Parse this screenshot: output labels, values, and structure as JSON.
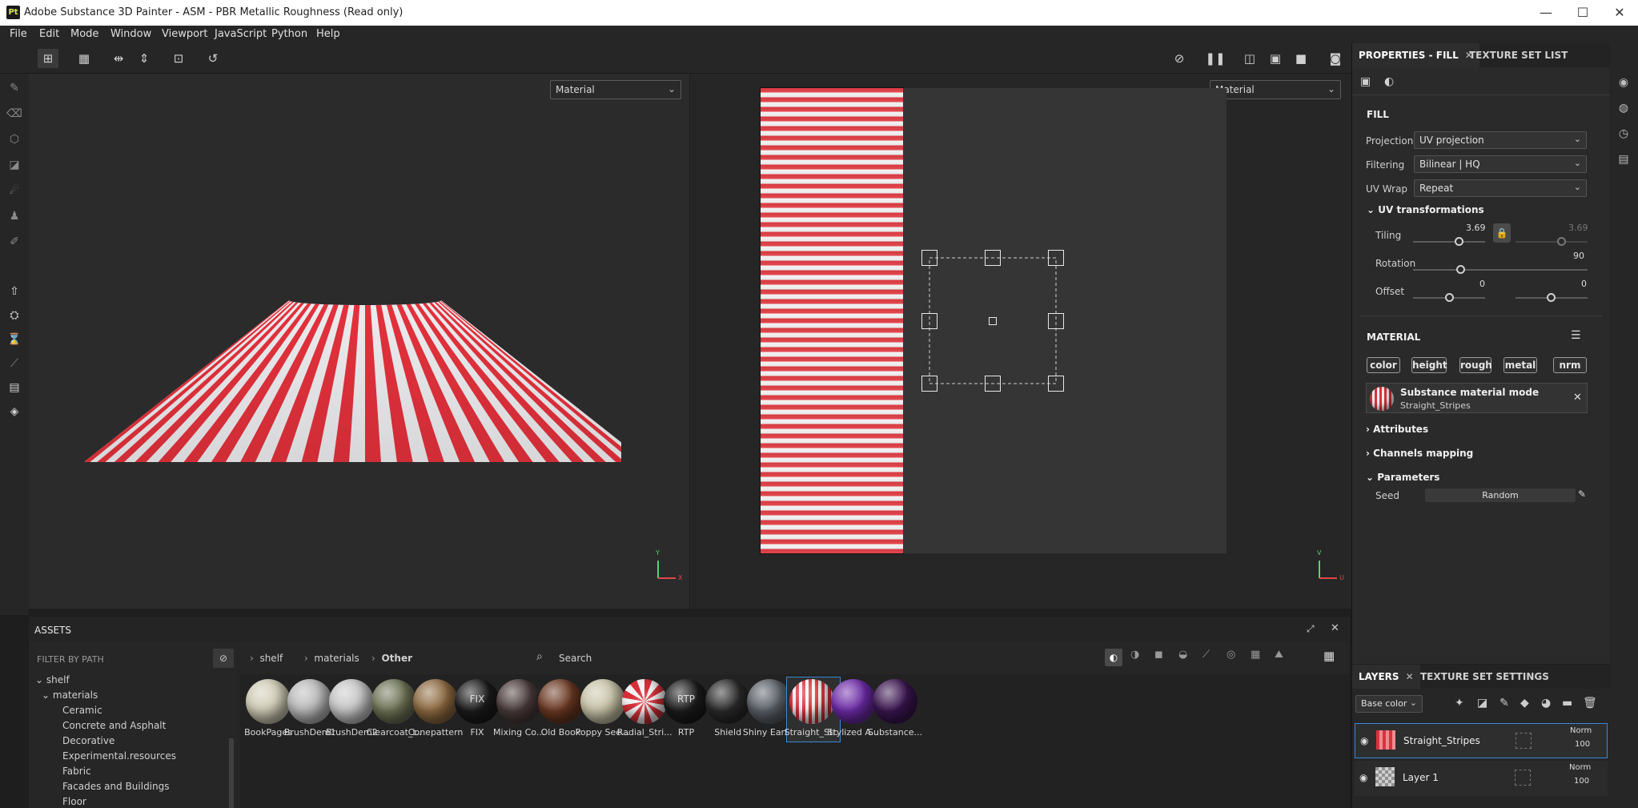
{
  "window": {
    "title": "Adobe Substance 3D Painter - ASM - PBR Metallic Roughness (Read only)",
    "logo": "Pt",
    "minimize": "—",
    "maximize": "☐",
    "close": "✕"
  },
  "menu": [
    "File",
    "Edit",
    "Mode",
    "Window",
    "Viewport",
    "JavaScript",
    "Python",
    "Help"
  ],
  "viewport3d": {
    "channel": "Material",
    "axis_x": "X",
    "axis_y": "Y"
  },
  "viewport2d": {
    "channel": "Material",
    "axis_u": "U",
    "axis_v": "V"
  },
  "properties": {
    "tab_active": "PROPERTIES - FILL",
    "tab_other": "TEXTURE SET LIST",
    "fill_title": "FILL",
    "projection_label": "Projection",
    "projection_value": "UV projection",
    "filtering_label": "Filtering",
    "filtering_value": "Bilinear | HQ",
    "uvwrap_label": "UV Wrap",
    "uvwrap_value": "Repeat",
    "uvtrans_title": "UV transformations",
    "tiling_label": "Tiling",
    "tiling_value": "3.69",
    "tiling_value2": "3.69",
    "rotation_label": "Rotation",
    "rotation_value": "90",
    "offset_label": "Offset",
    "offset_u": "0",
    "offset_v": "0",
    "material_title": "MATERIAL",
    "channels": [
      "color",
      "height",
      "rough",
      "metal",
      "nrm"
    ],
    "material_mode": "Substance material mode",
    "material_name": "Straight_Stripes",
    "attributes": "Attributes",
    "channels_mapping": "Channels mapping",
    "parameters": "Parameters",
    "seed_label": "Seed",
    "seed_value": "Random"
  },
  "assets": {
    "title": "ASSETS",
    "filter_placeholder": "FILTER BY PATH",
    "breadcrumb": [
      "shelf",
      "materials",
      "Other"
    ],
    "search_placeholder": "Search",
    "tree": [
      {
        "label": "shelf",
        "level": 0
      },
      {
        "label": "materials",
        "level": 1
      },
      {
        "label": "Ceramic",
        "level": 2
      },
      {
        "label": "Concrete and Asphalt",
        "level": 2
      },
      {
        "label": "Decorative",
        "level": 2
      },
      {
        "label": "Experimental.resources",
        "level": 2
      },
      {
        "label": "Fabric",
        "level": 2
      },
      {
        "label": "Facades and Buildings",
        "level": 2
      },
      {
        "label": "Floor",
        "level": 2
      }
    ],
    "items": [
      {
        "label": "BookPages",
        "color": "#cfcbb5"
      },
      {
        "label": "BrushDem1",
        "color": "#b9b9b9"
      },
      {
        "label": "BrushDem2",
        "color": "#c6c6c6"
      },
      {
        "label": "Clearcoat_t...",
        "color": "#6d7355"
      },
      {
        "label": "Conepattern",
        "color": "#8d6a40"
      },
      {
        "label": "FIX",
        "color": "#1b1b1b"
      },
      {
        "label": "Mixing Co...",
        "color": "#4a3a3a"
      },
      {
        "label": "Old Book",
        "color": "#6b3822"
      },
      {
        "label": "Poppy See...",
        "color": "#c8c3a7"
      },
      {
        "label": "Radial_Stri...",
        "color": "#d9303a"
      },
      {
        "label": "RTP",
        "color": "#1b1b1b"
      },
      {
        "label": "Shield",
        "color": "#2a2a2a"
      },
      {
        "label": "Shiny Eart...",
        "color": "#5a6068"
      },
      {
        "label": "Straight_Str...",
        "color": "#e0424b"
      },
      {
        "label": "Stylized A...",
        "color": "#6c2aa6"
      },
      {
        "label": "Substance...",
        "color": "#3a1550"
      }
    ]
  },
  "layers": {
    "tab_active": "LAYERS",
    "tab_other": "TEXTURE SET SETTINGS",
    "channel": "Base color",
    "items": [
      {
        "name": "Straight_Stripes",
        "blend": "Norm",
        "opacity": "100"
      },
      {
        "name": "Layer 1",
        "blend": "Norm",
        "opacity": "100"
      }
    ]
  }
}
